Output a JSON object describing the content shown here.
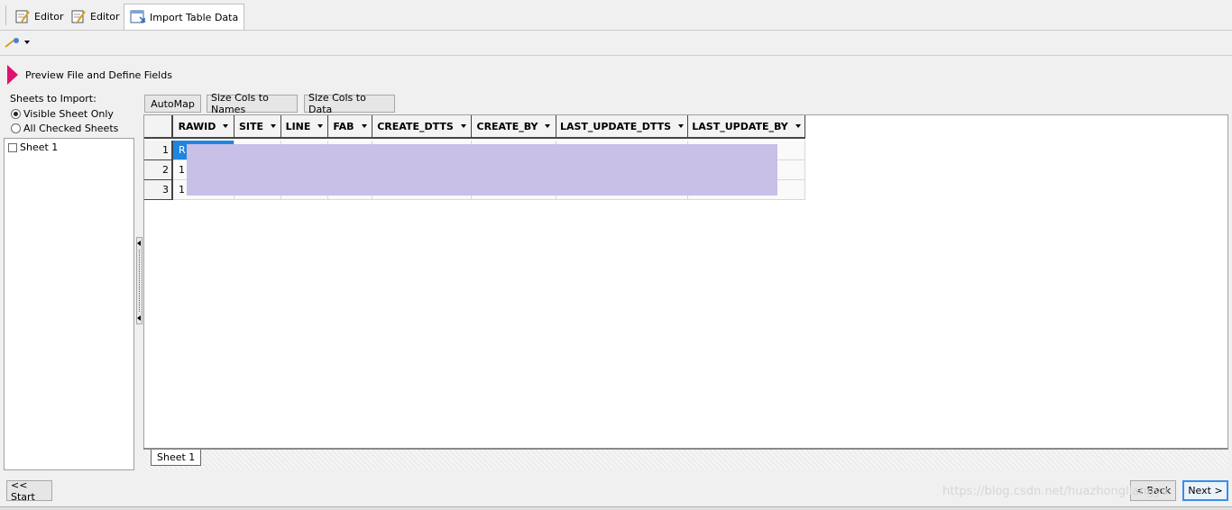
{
  "tabs": [
    {
      "label": "Editor"
    },
    {
      "label": "Editor"
    },
    {
      "label": "Import Table Data"
    }
  ],
  "toolbar": {
    "tool_icon": "magic-wand-icon"
  },
  "header": {
    "title": "Preview File and Define Fields"
  },
  "sheets": {
    "label": "Sheets to Import:",
    "options": [
      "Visible Sheet Only",
      "All Checked Sheets"
    ],
    "selected": "Visible Sheet Only",
    "list": [
      {
        "label": "Sheet 1",
        "checked": false
      }
    ]
  },
  "grid_buttons": {
    "automap": "AutoMap",
    "size_names": "Size Cols to Names",
    "size_data": "Size Cols to Data"
  },
  "columns": [
    "RAWID",
    "SITE",
    "LINE",
    "FAB",
    "CREATE_DTTS",
    "CREATE_BY",
    "LAST_UPDATE_DTTS",
    "LAST_UPDATE_BY"
  ],
  "rows": [
    {
      "num": "1",
      "first": "R"
    },
    {
      "num": "2",
      "first": "1"
    },
    {
      "num": "3",
      "first": "1"
    }
  ],
  "sheet_tab": "Sheet 1",
  "nav": {
    "start": "<< Start",
    "back": "< Back",
    "next": "Next >"
  },
  "watermark": "https://blog.csdn.net/huazhongliangyu"
}
